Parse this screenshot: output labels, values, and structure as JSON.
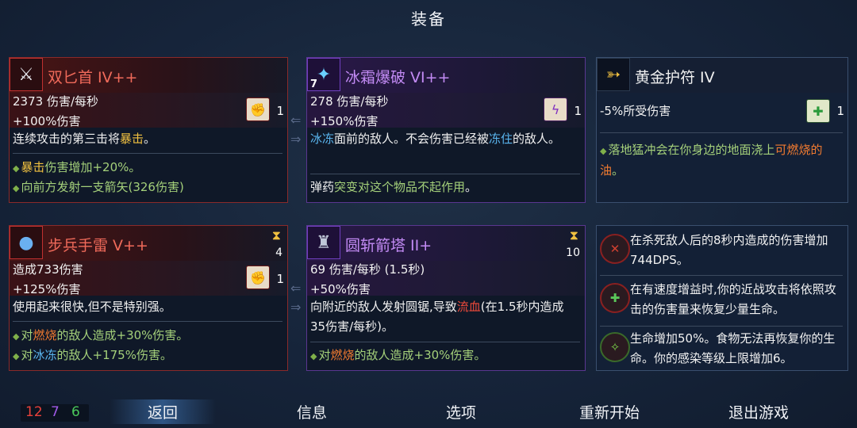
{
  "title": "装备",
  "weapons": [
    {
      "name": "双匕首 IV++",
      "icon": "twin-daggers-icon",
      "dps": "2373 伤害/每秒",
      "bonus": "+100%伤害",
      "scroll_count": "1",
      "desc_pre": "连续攻击的第三击将",
      "desc_hl": "暴击",
      "desc_post": "。",
      "bullet1_pre": "",
      "bullet1_hl": "暴击",
      "bullet1_post": "伤害增加+20%。",
      "bullet2": "向前方发射一支箭矢(326伤害)"
    },
    {
      "name": "冰霜爆破 VI++",
      "icon": "ice-blast-icon",
      "level_badge": "7",
      "dps": "278 伤害/每秒",
      "bonus": "+150%伤害",
      "scroll_count": "1",
      "desc_hl1": "冰冻",
      "desc_mid": "面前的敌人。不会伤害已经被",
      "desc_hl2": "冻住",
      "desc_post": "的敌人。",
      "ammo_pre": "弹药",
      "ammo_hl": "突变对这个物品不起作用",
      "ammo_post": "。"
    },
    {
      "name": "黄金护符 IV",
      "icon": "golden-amulet-icon",
      "stat": "-5%所受伤害",
      "scroll_count": "1",
      "bullet_pre": "落地猛冲会在你身边的地面浇上",
      "bullet_hl": "可燃烧的油",
      "bullet_post": "。"
    }
  ],
  "skills": [
    {
      "name": "步兵手雷 V++",
      "icon": "grenade-icon",
      "cooldown": "4",
      "dmg": "造成733伤害",
      "bonus": "+125%伤害",
      "scroll_count": "1",
      "desc": "使用起来很快,但不是特别强。",
      "b1_pre": "对",
      "b1_hl": "燃烧",
      "b1_post": "的敌人造成+30%伤害。",
      "b2_pre": "对",
      "b2_hl": "冰冻",
      "b2_post": "的敌人+175%伤害。"
    },
    {
      "name": "圆斩箭塔 II+",
      "icon": "turret-icon",
      "cooldown": "10",
      "dps": "69 伤害/每秒 (1.5秒)",
      "bonus": "+50%伤害",
      "desc_pre": "向附近的敌人发射圆锯,导致",
      "desc_hl": "流血",
      "desc_post": "(在1.5秒内造成35伤害/每秒)。",
      "b1_pre": "对",
      "b1_hl": "燃烧",
      "b1_post": "的敌人造成+30%伤害。"
    }
  ],
  "mutations": [
    {
      "icon": "kill-rhythm-icon",
      "text": "在杀死敌人后的8秒内造成的伤害增加744DPS。"
    },
    {
      "icon": "speed-heal-icon",
      "text": "在有速度增益时,你的近战攻击将依照攻击的伤害量来恢复少量生命。"
    },
    {
      "icon": "necromancy-icon",
      "text": "生命增加50%。食物无法再恢复你的生命。你的感染等级上限增加6。"
    }
  ],
  "counters": {
    "brutality": "12",
    "tactics": "7",
    "survival": "6"
  },
  "colors": {
    "brutality": "#e8413a",
    "tactics": "#a05ae8",
    "survival": "#4ac85a"
  },
  "nav": [
    "返回",
    "信息",
    "选项",
    "重新开始",
    "退出游戏"
  ]
}
